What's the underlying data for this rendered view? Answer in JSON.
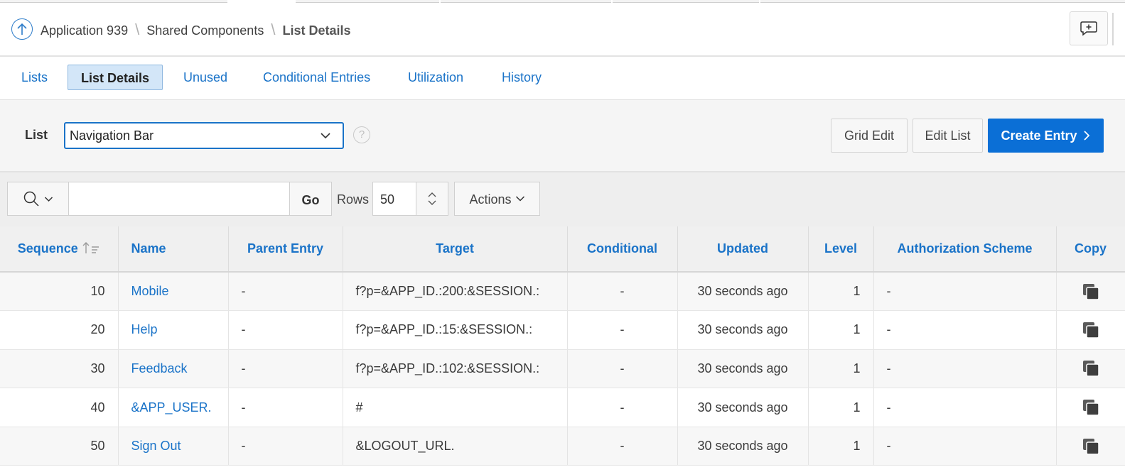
{
  "breadcrumb": {
    "items": [
      "Application 939",
      "Shared Components"
    ],
    "current": "List Details"
  },
  "tabs": [
    {
      "label": "Lists",
      "active": false
    },
    {
      "label": "List Details",
      "active": true
    },
    {
      "label": "Unused",
      "active": false
    },
    {
      "label": "Conditional Entries",
      "active": false
    },
    {
      "label": "Utilization",
      "active": false
    },
    {
      "label": "History",
      "active": false
    }
  ],
  "list_selector": {
    "label": "List",
    "value": "Navigation Bar",
    "help": "?"
  },
  "buttons": {
    "grid_edit": "Grid Edit",
    "edit_list": "Edit List",
    "create_entry": "Create Entry"
  },
  "toolbar": {
    "search_value": "",
    "go": "Go",
    "rows_label": "Rows",
    "rows_value": "50",
    "actions": "Actions"
  },
  "table": {
    "columns": [
      "Sequence",
      "Name",
      "Parent Entry",
      "Target",
      "Conditional",
      "Updated",
      "Level",
      "Authorization Scheme",
      "Copy"
    ],
    "sort": {
      "column": "Sequence",
      "direction": "ascending"
    },
    "rows": [
      {
        "sequence": "10",
        "name": "Mobile",
        "parent": "-",
        "target": "f?p=&APP_ID.:200:&SESSION.:",
        "conditional": "-",
        "updated": "30 seconds ago",
        "level": "1",
        "auth": "-"
      },
      {
        "sequence": "20",
        "name": "Help",
        "parent": "-",
        "target": "f?p=&APP_ID.:15:&SESSION.:",
        "conditional": "-",
        "updated": "30 seconds ago",
        "level": "1",
        "auth": "-"
      },
      {
        "sequence": "30",
        "name": "Feedback",
        "parent": "-",
        "target": "f?p=&APP_ID.:102:&SESSION.:",
        "conditional": "-",
        "updated": "30 seconds ago",
        "level": "1",
        "auth": "-"
      },
      {
        "sequence": "40",
        "name": "&APP_USER.",
        "parent": "-",
        "target": "#",
        "conditional": "-",
        "updated": "30 seconds ago",
        "level": "1",
        "auth": "-"
      },
      {
        "sequence": "50",
        "name": "Sign Out",
        "parent": "-",
        "target": "&LOGOUT_URL.",
        "conditional": "-",
        "updated": "30 seconds ago",
        "level": "1",
        "auth": "-"
      }
    ]
  },
  "colors": {
    "accent": "#1a73c8",
    "primary_button": "#0b6fd6",
    "active_tab_bg": "#d3e6f8"
  }
}
